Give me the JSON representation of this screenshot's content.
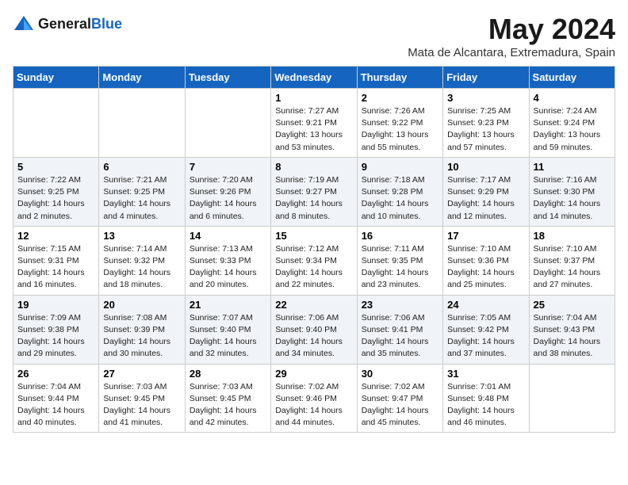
{
  "header": {
    "logo_general": "General",
    "logo_blue": "Blue",
    "month_title": "May 2024",
    "location": "Mata de Alcantara, Extremadura, Spain"
  },
  "weekdays": [
    "Sunday",
    "Monday",
    "Tuesday",
    "Wednesday",
    "Thursday",
    "Friday",
    "Saturday"
  ],
  "weeks": [
    [
      {
        "day": "",
        "sunrise": "",
        "sunset": "",
        "daylight": ""
      },
      {
        "day": "",
        "sunrise": "",
        "sunset": "",
        "daylight": ""
      },
      {
        "day": "",
        "sunrise": "",
        "sunset": "",
        "daylight": ""
      },
      {
        "day": "1",
        "sunrise": "Sunrise: 7:27 AM",
        "sunset": "Sunset: 9:21 PM",
        "daylight": "Daylight: 13 hours and 53 minutes."
      },
      {
        "day": "2",
        "sunrise": "Sunrise: 7:26 AM",
        "sunset": "Sunset: 9:22 PM",
        "daylight": "Daylight: 13 hours and 55 minutes."
      },
      {
        "day": "3",
        "sunrise": "Sunrise: 7:25 AM",
        "sunset": "Sunset: 9:23 PM",
        "daylight": "Daylight: 13 hours and 57 minutes."
      },
      {
        "day": "4",
        "sunrise": "Sunrise: 7:24 AM",
        "sunset": "Sunset: 9:24 PM",
        "daylight": "Daylight: 13 hours and 59 minutes."
      }
    ],
    [
      {
        "day": "5",
        "sunrise": "Sunrise: 7:22 AM",
        "sunset": "Sunset: 9:25 PM",
        "daylight": "Daylight: 14 hours and 2 minutes."
      },
      {
        "day": "6",
        "sunrise": "Sunrise: 7:21 AM",
        "sunset": "Sunset: 9:25 PM",
        "daylight": "Daylight: 14 hours and 4 minutes."
      },
      {
        "day": "7",
        "sunrise": "Sunrise: 7:20 AM",
        "sunset": "Sunset: 9:26 PM",
        "daylight": "Daylight: 14 hours and 6 minutes."
      },
      {
        "day": "8",
        "sunrise": "Sunrise: 7:19 AM",
        "sunset": "Sunset: 9:27 PM",
        "daylight": "Daylight: 14 hours and 8 minutes."
      },
      {
        "day": "9",
        "sunrise": "Sunrise: 7:18 AM",
        "sunset": "Sunset: 9:28 PM",
        "daylight": "Daylight: 14 hours and 10 minutes."
      },
      {
        "day": "10",
        "sunrise": "Sunrise: 7:17 AM",
        "sunset": "Sunset: 9:29 PM",
        "daylight": "Daylight: 14 hours and 12 minutes."
      },
      {
        "day": "11",
        "sunrise": "Sunrise: 7:16 AM",
        "sunset": "Sunset: 9:30 PM",
        "daylight": "Daylight: 14 hours and 14 minutes."
      }
    ],
    [
      {
        "day": "12",
        "sunrise": "Sunrise: 7:15 AM",
        "sunset": "Sunset: 9:31 PM",
        "daylight": "Daylight: 14 hours and 16 minutes."
      },
      {
        "day": "13",
        "sunrise": "Sunrise: 7:14 AM",
        "sunset": "Sunset: 9:32 PM",
        "daylight": "Daylight: 14 hours and 18 minutes."
      },
      {
        "day": "14",
        "sunrise": "Sunrise: 7:13 AM",
        "sunset": "Sunset: 9:33 PM",
        "daylight": "Daylight: 14 hours and 20 minutes."
      },
      {
        "day": "15",
        "sunrise": "Sunrise: 7:12 AM",
        "sunset": "Sunset: 9:34 PM",
        "daylight": "Daylight: 14 hours and 22 minutes."
      },
      {
        "day": "16",
        "sunrise": "Sunrise: 7:11 AM",
        "sunset": "Sunset: 9:35 PM",
        "daylight": "Daylight: 14 hours and 23 minutes."
      },
      {
        "day": "17",
        "sunrise": "Sunrise: 7:10 AM",
        "sunset": "Sunset: 9:36 PM",
        "daylight": "Daylight: 14 hours and 25 minutes."
      },
      {
        "day": "18",
        "sunrise": "Sunrise: 7:10 AM",
        "sunset": "Sunset: 9:37 PM",
        "daylight": "Daylight: 14 hours and 27 minutes."
      }
    ],
    [
      {
        "day": "19",
        "sunrise": "Sunrise: 7:09 AM",
        "sunset": "Sunset: 9:38 PM",
        "daylight": "Daylight: 14 hours and 29 minutes."
      },
      {
        "day": "20",
        "sunrise": "Sunrise: 7:08 AM",
        "sunset": "Sunset: 9:39 PM",
        "daylight": "Daylight: 14 hours and 30 minutes."
      },
      {
        "day": "21",
        "sunrise": "Sunrise: 7:07 AM",
        "sunset": "Sunset: 9:40 PM",
        "daylight": "Daylight: 14 hours and 32 minutes."
      },
      {
        "day": "22",
        "sunrise": "Sunrise: 7:06 AM",
        "sunset": "Sunset: 9:40 PM",
        "daylight": "Daylight: 14 hours and 34 minutes."
      },
      {
        "day": "23",
        "sunrise": "Sunrise: 7:06 AM",
        "sunset": "Sunset: 9:41 PM",
        "daylight": "Daylight: 14 hours and 35 minutes."
      },
      {
        "day": "24",
        "sunrise": "Sunrise: 7:05 AM",
        "sunset": "Sunset: 9:42 PM",
        "daylight": "Daylight: 14 hours and 37 minutes."
      },
      {
        "day": "25",
        "sunrise": "Sunrise: 7:04 AM",
        "sunset": "Sunset: 9:43 PM",
        "daylight": "Daylight: 14 hours and 38 minutes."
      }
    ],
    [
      {
        "day": "26",
        "sunrise": "Sunrise: 7:04 AM",
        "sunset": "Sunset: 9:44 PM",
        "daylight": "Daylight: 14 hours and 40 minutes."
      },
      {
        "day": "27",
        "sunrise": "Sunrise: 7:03 AM",
        "sunset": "Sunset: 9:45 PM",
        "daylight": "Daylight: 14 hours and 41 minutes."
      },
      {
        "day": "28",
        "sunrise": "Sunrise: 7:03 AM",
        "sunset": "Sunset: 9:45 PM",
        "daylight": "Daylight: 14 hours and 42 minutes."
      },
      {
        "day": "29",
        "sunrise": "Sunrise: 7:02 AM",
        "sunset": "Sunset: 9:46 PM",
        "daylight": "Daylight: 14 hours and 44 minutes."
      },
      {
        "day": "30",
        "sunrise": "Sunrise: 7:02 AM",
        "sunset": "Sunset: 9:47 PM",
        "daylight": "Daylight: 14 hours and 45 minutes."
      },
      {
        "day": "31",
        "sunrise": "Sunrise: 7:01 AM",
        "sunset": "Sunset: 9:48 PM",
        "daylight": "Daylight: 14 hours and 46 minutes."
      },
      {
        "day": "",
        "sunrise": "",
        "sunset": "",
        "daylight": ""
      }
    ]
  ]
}
